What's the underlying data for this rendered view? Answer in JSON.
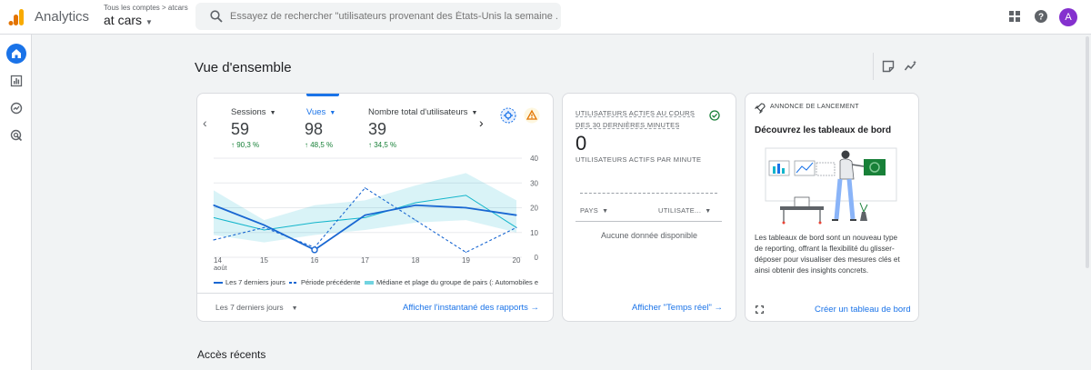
{
  "app": {
    "title": "Analytics",
    "account_breadcrumb": "Tous les comptes > atcars",
    "property_name": "at cars",
    "avatar_letter": "A"
  },
  "search": {
    "placeholder": "Essayez de rechercher \"utilisateurs provenant des États-Unis la semaine ..."
  },
  "page": {
    "title": "Vue d'ensemble",
    "recent_heading": "Accès récents"
  },
  "overview_card": {
    "metrics": [
      {
        "label": "Sessions",
        "value": "59",
        "delta": "↑ 90,3 %"
      },
      {
        "label": "Vues",
        "value": "98",
        "delta": "↑ 48,5 %",
        "selected": true
      },
      {
        "label": "Nombre total d'utilisateurs",
        "value": "39",
        "delta": "↑ 34,5 %"
      }
    ],
    "legend": [
      "Les 7 derniers jours",
      "Période précédente",
      "Médiane et plage du groupe de pairs (: Automobiles e"
    ],
    "date_range": "Les 7 derniers jours",
    "link": "Afficher l'instantané des rapports"
  },
  "chart_data": {
    "type": "line",
    "x": [
      "14",
      "15",
      "16",
      "17",
      "18",
      "19",
      "20"
    ],
    "x_sublabel": "août",
    "ylim": [
      0,
      40
    ],
    "yticks": [
      "40",
      "30",
      "20",
      "10",
      "0"
    ],
    "series": [
      {
        "name": "Les 7 derniers jours",
        "values": [
          21,
          13,
          3,
          17,
          21,
          20,
          17
        ],
        "color": "#1967d2",
        "style": "solid"
      },
      {
        "name": "Période précédente",
        "values": [
          7,
          12,
          4,
          28,
          15,
          2,
          12
        ],
        "color": "#1967d2",
        "style": "dashed"
      },
      {
        "name": "Médiane et plage du groupe de pairs (: Automobiles e",
        "values": [
          16,
          11,
          14,
          16,
          22,
          25,
          12
        ],
        "band_high": [
          27,
          15,
          21,
          23,
          29,
          34,
          23
        ],
        "band_low": [
          9,
          6,
          9,
          11,
          14,
          15,
          10
        ],
        "color": "#12b5cb",
        "style": "band"
      }
    ]
  },
  "realtime_card": {
    "title": "UTILISATEURS ACTIFS AU COURS DES 30 DERNIÈRES MINUTES",
    "value": "0",
    "subtitle": "UTILISATEURS ACTIFS PAR MINUTE",
    "col_country": "PAYS",
    "col_users": "UTILISATE...",
    "empty": "Aucune donnée disponible",
    "link": "Afficher \"Temps réel\""
  },
  "launch_card": {
    "label": "ANNONCE DE LANCEMENT",
    "title": "Découvrez les tableaux de bord",
    "body": "Les tableaux de bord sont un nouveau type de reporting, offrant la flexibilité du glisser-déposer pour visualiser des mesures clés et ainsi obtenir des insights concrets.",
    "link": "Créer un tableau de bord"
  },
  "colors": {
    "accent": "#1a73e8",
    "positive": "#188038",
    "teal": "#12b5cb",
    "logo_orange": "#f9ab00",
    "logo_dark": "#e37400"
  }
}
